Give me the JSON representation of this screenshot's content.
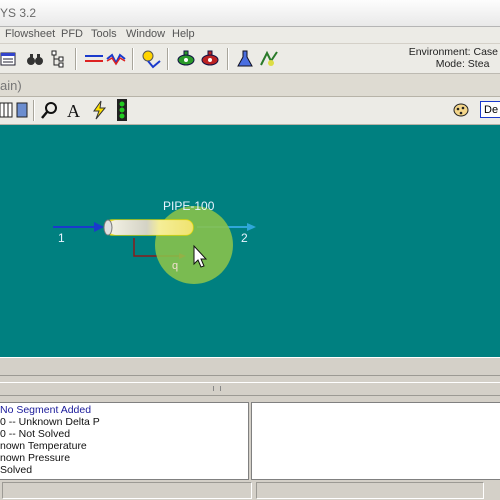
{
  "app": {
    "title": "YS 3.2"
  },
  "menu": [
    "Flowsheet",
    "PFD",
    "Tools",
    "Window",
    "Help"
  ],
  "environment": {
    "env_text": "Environment: Case",
    "mode_text": "Mode: Stea"
  },
  "window_title": "ain)",
  "toolbar2": {
    "dropdown_label": "De"
  },
  "pfd": {
    "pipe_label": "PIPE-100",
    "stream_in": "1",
    "stream_out": "2",
    "energy_stream": "q"
  },
  "status_messages": [
    {
      "text": "No Segment Added",
      "color": "#1a1a9a"
    },
    {
      "text": "0 -- Unknown Delta P",
      "color": "#111111"
    },
    {
      "text": "0 -- Not Solved",
      "color": "#111111"
    },
    {
      "text": "nown Temperature",
      "color": "#111111"
    },
    {
      "text": "nown Pressure",
      "color": "#111111"
    },
    {
      "text": "Solved",
      "color": "#111111"
    }
  ],
  "colors": {
    "canvas": "#008080",
    "pipe_highlight": "#f0e68c",
    "cursor_circle": "#8bc34a"
  }
}
